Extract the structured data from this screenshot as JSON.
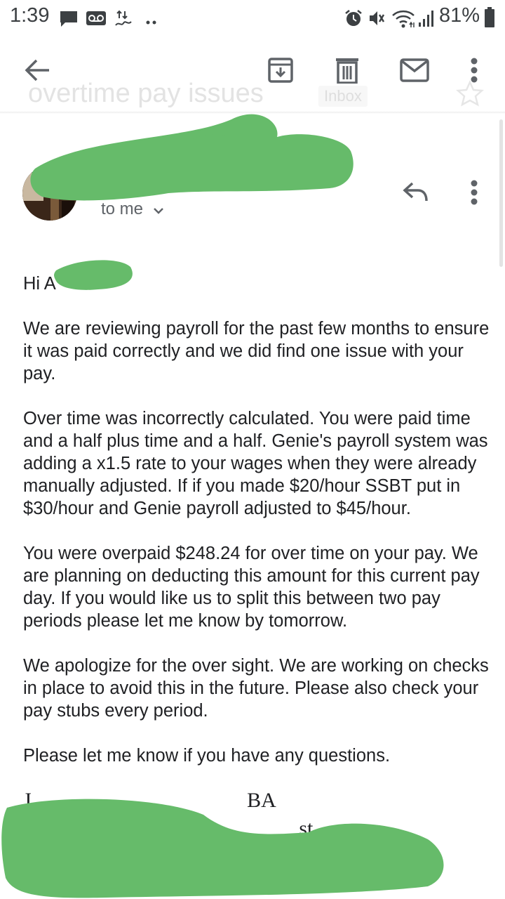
{
  "status_bar": {
    "time": "1:39",
    "battery": "81%",
    "icons": [
      "message-icon",
      "voicemail-icon",
      "data-transfer-icon",
      "more-notifications-icon",
      "alarm-icon",
      "mute-icon",
      "wifi-icon",
      "signal-icon",
      "battery-icon"
    ]
  },
  "toolbar": {
    "back_icon": "arrow-back-icon",
    "archive_icon": "archive-icon",
    "delete_icon": "trash-icon",
    "mark_unread_icon": "mail-icon",
    "more_icon": "more-vert-icon"
  },
  "email": {
    "subject": "overtime pay issues",
    "label": "Inbox",
    "recipient_line": "to me",
    "greeting": "Hi A",
    "paragraphs": [
      "We are reviewing payroll for the past few months to ensure it was paid correctly and we did find one issue with your pay.",
      "Over time was incorrectly calculated. You were paid time and a half plus time and a half. Genie's payroll system was adding a x1.5 rate to your wages when they were already manually adjusted. If if you made $20/hour SSBT put in $30/hour and Genie payroll adjusted to $45/hour.",
      "You were overpaid $248.24 for over time on your pay. We are planning on deducting this amount for this current pay day. If you would like us to split this between two pay periods please let me know by tomorrow.",
      "We apologize for the over sight. We are working on checks in place to avoid this in the future. Please also check your pay stubs every period."
    ],
    "closing": "Please let me know if you have any questions.",
    "signature_line1": "J                                         BA",
    "signature_line2": "Boa                                              st"
  },
  "colors": {
    "redaction": "#66bb6a",
    "text": "#202124",
    "secondary_text": "#5f6368",
    "icon": "#5f6368"
  }
}
